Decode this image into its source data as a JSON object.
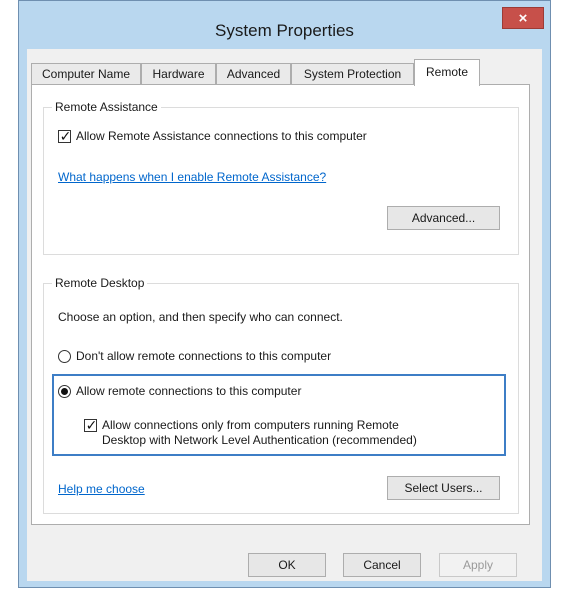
{
  "window": {
    "title": "System Properties",
    "close_glyph": "×"
  },
  "tabs": [
    {
      "label": "Computer Name",
      "active": false
    },
    {
      "label": "Hardware",
      "active": false
    },
    {
      "label": "Advanced",
      "active": false
    },
    {
      "label": "System Protection",
      "active": false
    },
    {
      "label": "Remote",
      "active": true
    }
  ],
  "remote_assistance": {
    "group_title": "Remote Assistance",
    "allow_checkbox": {
      "label": "Allow Remote Assistance connections to this computer",
      "checked": true
    },
    "help_link": "What happens when I enable Remote Assistance?",
    "advanced_button": "Advanced..."
  },
  "remote_desktop": {
    "group_title": "Remote Desktop",
    "intro": "Choose an option, and then specify who can connect.",
    "options": [
      {
        "label": "Don't allow remote connections to this computer",
        "selected": false
      },
      {
        "label": "Allow remote connections to this computer",
        "selected": true
      }
    ],
    "nla_checkbox": {
      "label_line1": "Allow connections only from computers running Remote",
      "label_line2": "Desktop with Network Level Authentication (recommended)",
      "checked": true
    },
    "help_link": "Help me choose",
    "select_users_button": "Select Users..."
  },
  "footer": {
    "ok": "OK",
    "cancel": "Cancel",
    "apply": "Apply",
    "apply_enabled": false
  },
  "icons": {
    "check_glyph": "✓"
  },
  "colors": {
    "title_bg": "#b9d7ef",
    "close_bg": "#c7504a",
    "link": "#0066cc",
    "focus": "#3d7ec6"
  }
}
